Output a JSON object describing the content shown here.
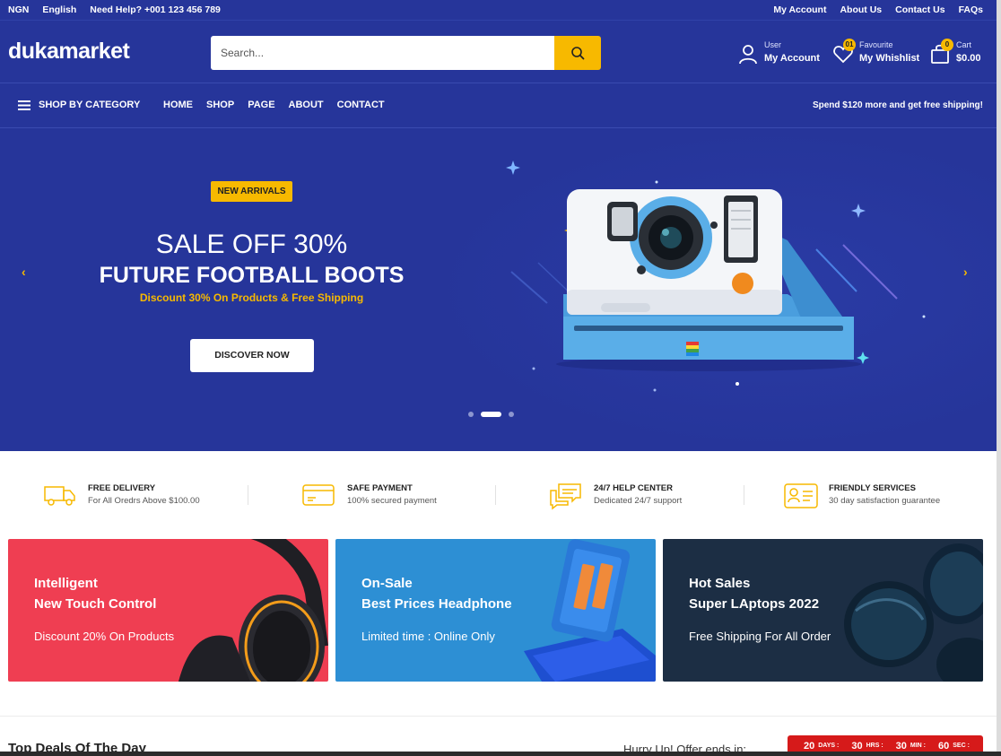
{
  "topbar": {
    "currency": "NGN",
    "language": "English",
    "help": "Need Help? +001 123 456 789",
    "links": [
      "My Account",
      "About Us",
      "Contact Us",
      "FAQs"
    ]
  },
  "header": {
    "logo": "dukamarket",
    "search_placeholder": "Search...",
    "account": {
      "small": "User",
      "big": "My Account"
    },
    "wishlist": {
      "small": "Favourite",
      "big": "My Whishlist",
      "count": "01"
    },
    "cart": {
      "small": "Cart",
      "big": "$0.00",
      "count": "0"
    }
  },
  "nav": {
    "category": "SHOP BY CATEGORY",
    "links": [
      "HOME",
      "SHOP",
      "PAGE",
      "ABOUT",
      "CONTACT"
    ],
    "promo": "Spend $120 more and get free shipping!"
  },
  "hero": {
    "tag": "NEW ARRIVALS",
    "sale": "SALE OFF 30%",
    "title": "FUTURE FOOTBALL BOOTS",
    "subtitle": "Discount 30% On Products & Free Shipping",
    "button": "DISCOVER NOW",
    "prev": "‹",
    "next": "›",
    "active_slide": 2,
    "slides": 3
  },
  "services": [
    {
      "title": "FREE DELIVERY",
      "sub": "For All Oredrs Above $100.00",
      "icon": "truck-icon"
    },
    {
      "title": "SAFE PAYMENT",
      "sub": "100% secured payment",
      "icon": "credit-card-icon"
    },
    {
      "title": "24/7 HELP CENTER",
      "sub": "Dedicated 24/7 support",
      "icon": "chat-icon"
    },
    {
      "title": "FRIENDLY SERVICES",
      "sub": "30 day satisfaction guarantee",
      "icon": "id-card-icon"
    }
  ],
  "banners": [
    {
      "line1": "Intelligent",
      "line2": "New Touch Control",
      "line3": "Discount 20% On Products",
      "color": "#ef3e52"
    },
    {
      "line1": "On-Sale",
      "line2": "Best Prices Headphone",
      "line3": "Limited time : Online Only",
      "color": "#2d8fd4"
    },
    {
      "line1": "Hot Sales",
      "line2": "Super LAptops 2022",
      "line3": "Free Shipping For All Order",
      "color": "#1c2e44"
    }
  ],
  "deals": {
    "title": "Top Deals Of The Day",
    "hurry": "Hurry Up! Offer ends in:",
    "timer": [
      {
        "num": "20",
        "label": "DAYS :"
      },
      {
        "num": "30",
        "label": "HRS :"
      },
      {
        "num": "30",
        "label": "MIN :"
      },
      {
        "num": "60",
        "label": "SEC :"
      }
    ]
  },
  "colors": {
    "brand": "#26359a",
    "accent": "#f7b900",
    "timer": "#d61a1a"
  }
}
